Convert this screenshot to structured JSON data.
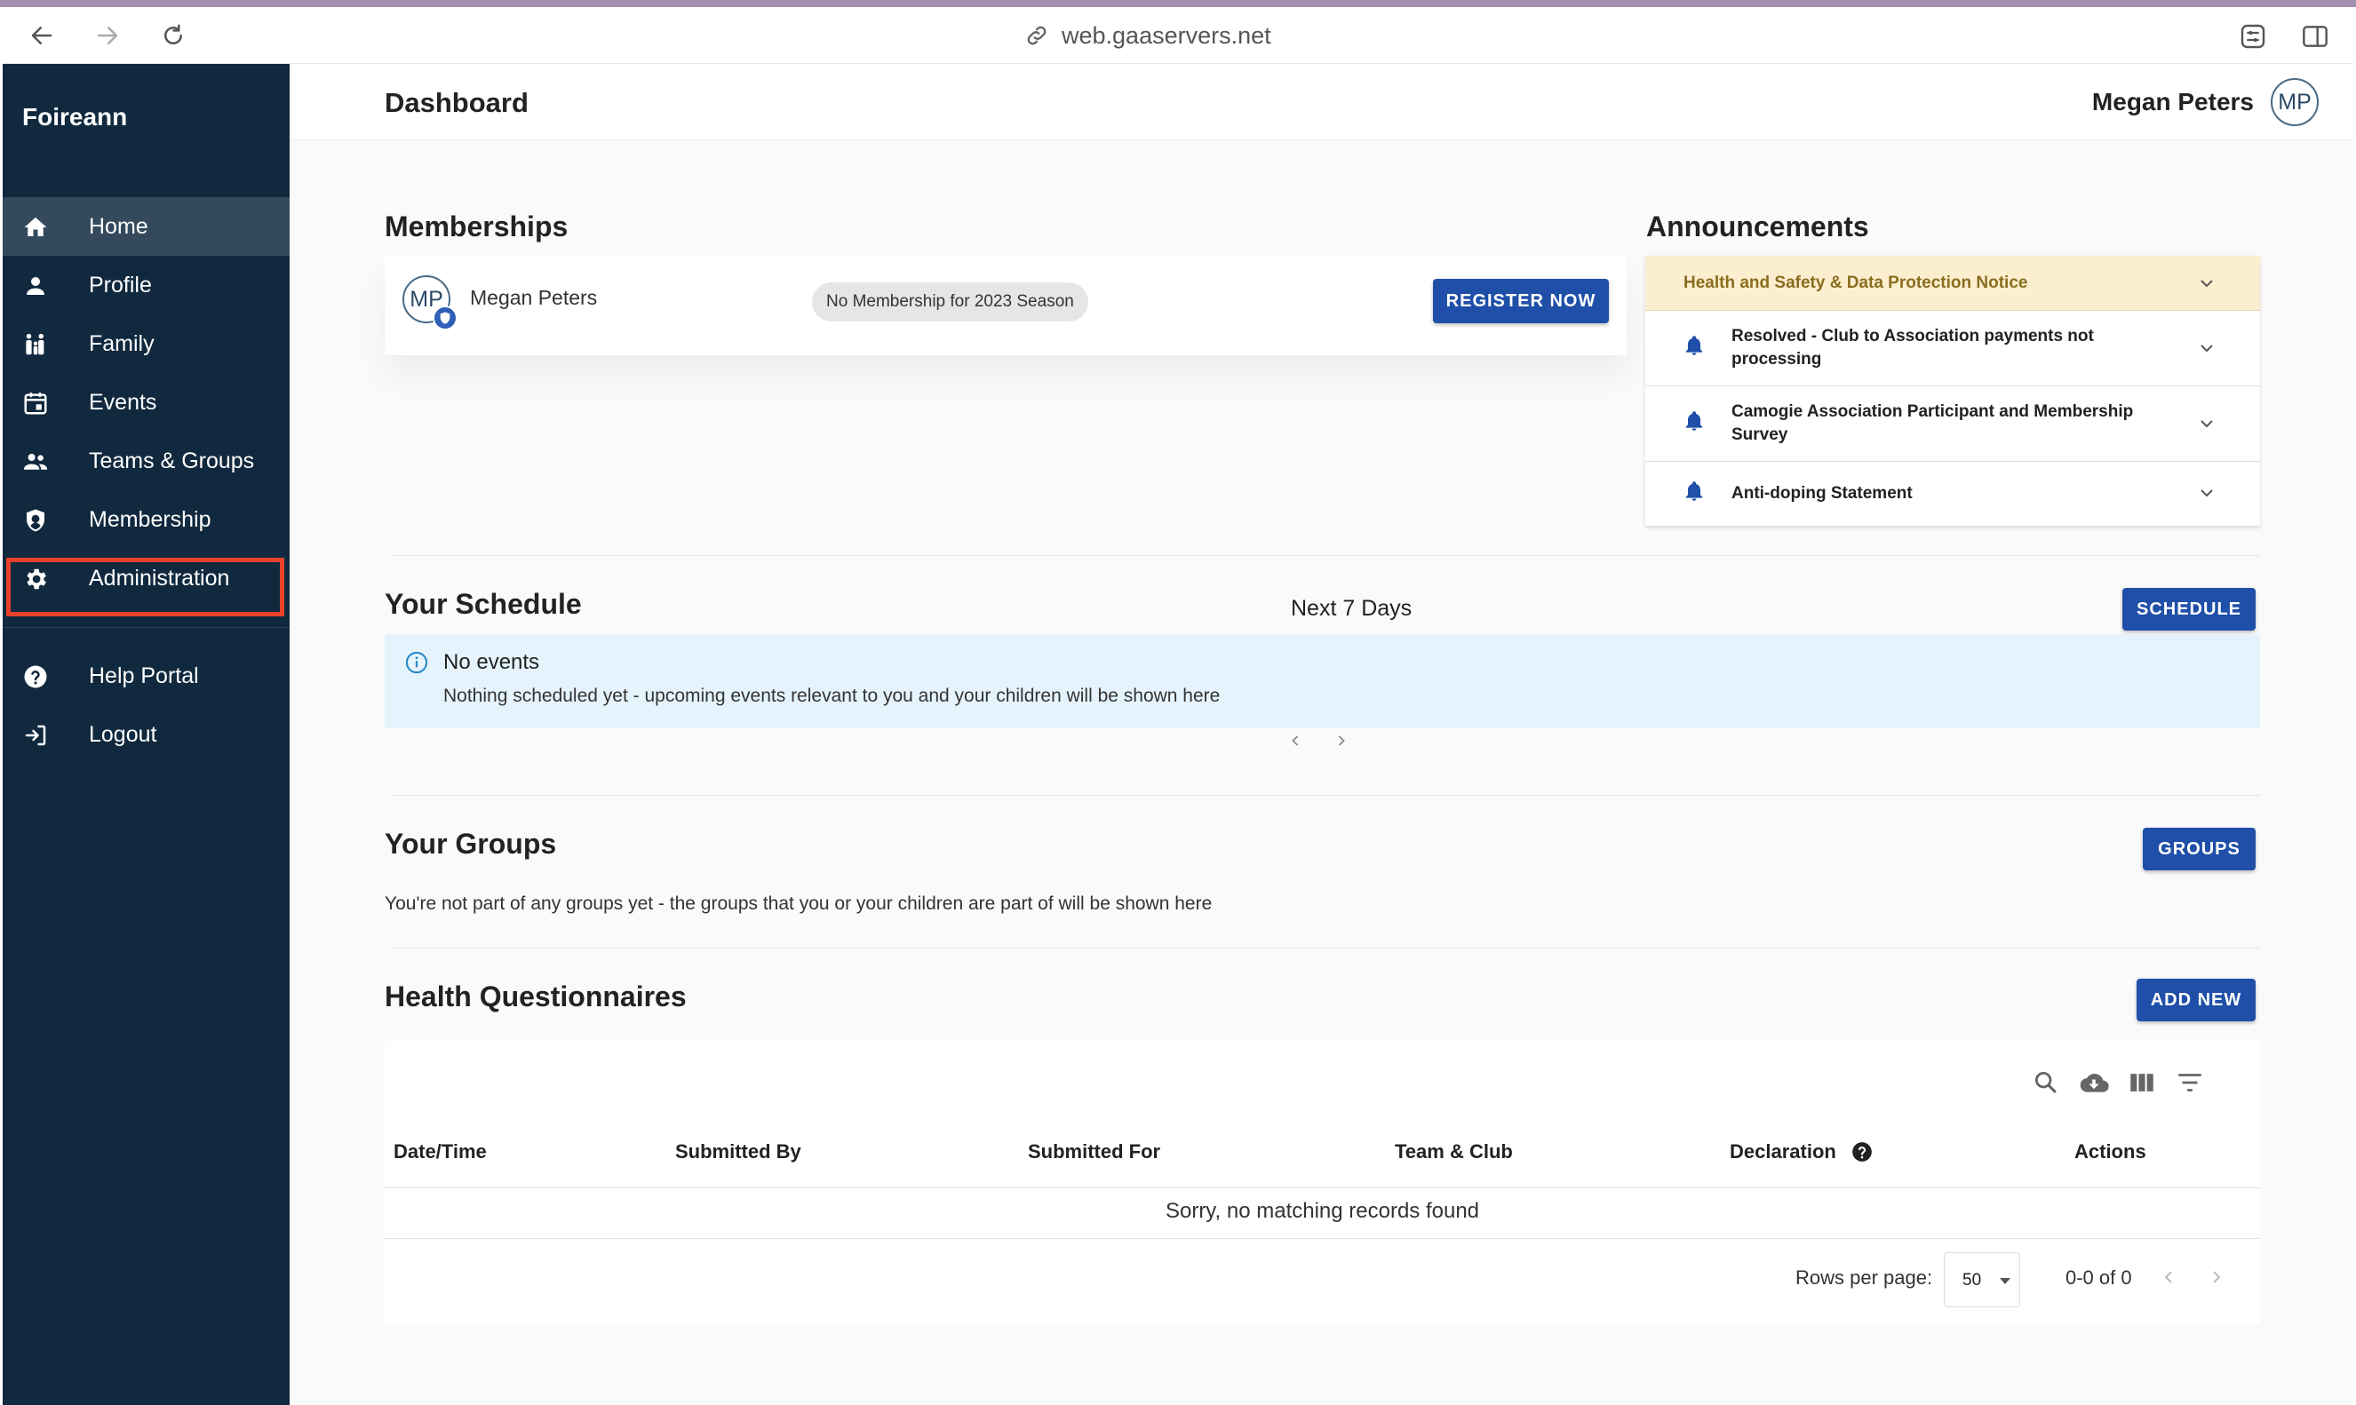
{
  "browser": {
    "url": "web.gaaservers.net"
  },
  "sidebar": {
    "brand": "Foireann",
    "items": [
      {
        "label": "Home",
        "icon": "home-icon"
      },
      {
        "label": "Profile",
        "icon": "person-icon"
      },
      {
        "label": "Family",
        "icon": "family-icon"
      },
      {
        "label": "Events",
        "icon": "calendar-icon"
      },
      {
        "label": "Teams & Groups",
        "icon": "group-icon"
      },
      {
        "label": "Membership",
        "icon": "shield-icon"
      },
      {
        "label": "Administration",
        "icon": "gear-icon"
      }
    ],
    "secondary": [
      {
        "label": "Help Portal",
        "icon": "help-icon"
      },
      {
        "label": "Logout",
        "icon": "logout-icon"
      }
    ],
    "active": "Home"
  },
  "header": {
    "title": "Dashboard",
    "user_name": "Megan Peters",
    "user_initials": "MP"
  },
  "memberships": {
    "title": "Memberships",
    "member_initials": "MP",
    "member_name": "Megan Peters",
    "status": "No Membership for 2023 Season",
    "register_label": "REGISTER NOW"
  },
  "announcements": {
    "title": "Announcements",
    "items": [
      {
        "text": "Health and Safety & Data Protection Notice",
        "highlighted": true
      },
      {
        "text": "Resolved - Club to Association payments not processing"
      },
      {
        "text": "Camogie Association Participant and Membership Survey"
      },
      {
        "text": "Anti-doping Statement"
      }
    ]
  },
  "schedule": {
    "title": "Your Schedule",
    "range_label": "Next 7 Days",
    "button_label": "SCHEDULE",
    "empty_title": "No events",
    "empty_body": "Nothing scheduled yet - upcoming events relevant to you and your children will be shown here"
  },
  "groups": {
    "title": "Your Groups",
    "button_label": "GROUPS",
    "empty_text": "You're not part of any groups yet - the groups that you or your children are part of will be shown here"
  },
  "questionnaires": {
    "title": "Health Questionnaires",
    "button_label": "ADD NEW",
    "columns": [
      "Date/Time",
      "Submitted By",
      "Submitted For",
      "Team & Club",
      "Declaration",
      "Actions"
    ],
    "empty_text": "Sorry, no matching records found",
    "rows_per_page_label": "Rows per page:",
    "rows_per_page_value": "50",
    "range_text": "0-0 of 0"
  },
  "colors": {
    "sidebar_bg": "#11293e",
    "primary_button": "#1f4fa8",
    "highlight_outline": "#e8402a",
    "announcement_highlight": "#fcefcf",
    "info_box": "#e5f4fc"
  }
}
